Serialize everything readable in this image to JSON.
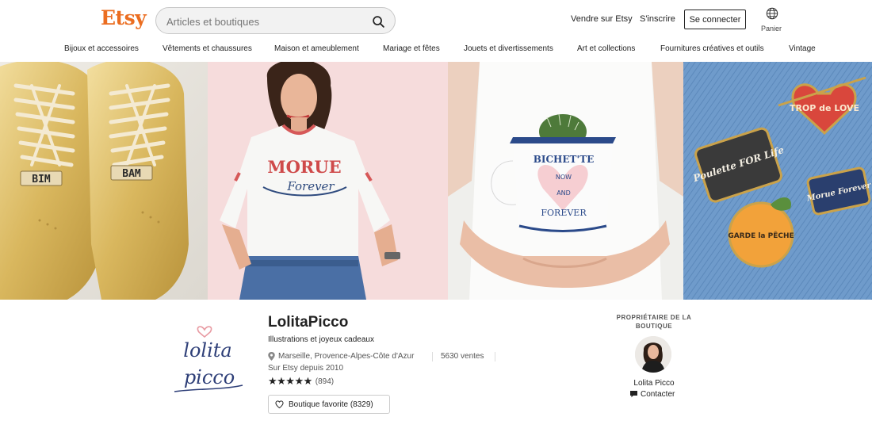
{
  "header": {
    "logo": "Etsy",
    "search_placeholder": "Articles et boutiques",
    "sell_link": "Vendre sur Etsy",
    "register_link": "S'inscrire",
    "signin_button": "Se connecter",
    "cart_label": "Panier",
    "brand_color": "#eb6d20"
  },
  "categories": [
    "Bijoux et accessoires",
    "Vêtements et chaussures",
    "Maison et ameublement",
    "Mariage et fêtes",
    "Jouets et divertissements",
    "Art et collections",
    "Fournitures créatives et outils",
    "Vintage"
  ],
  "banner": {
    "shoes": [
      "BIM",
      "BAM"
    ],
    "tshirt_top": "MORUE",
    "tshirt_bottom": "Forever",
    "mug_lines": [
      "BICHET'TE",
      "NOW",
      "AND",
      "FOREVER"
    ],
    "pins": [
      "TROP de LOVE",
      "Poulette FOR Life",
      "Morue Forever",
      "GARDE la PÊCHE"
    ]
  },
  "shop": {
    "logo_line1": "lolita",
    "logo_line2": "picco",
    "name": "LolitaPicco",
    "tagline": "Illustrations et joyeux cadeaux",
    "location": "Marseille, Provence-Alpes-Côte d'Azur",
    "sales": "5630 ventes",
    "since": "Sur Etsy depuis 2010",
    "stars": "★★★★★",
    "rating": 5,
    "review_count": "(894)",
    "favorite_button": "Boutique favorite (8329)"
  },
  "owner": {
    "title": "PROPRIÉTAIRE DE LA BOUTIQUE",
    "name": "Lolita Picco",
    "contact": "Contacter"
  }
}
